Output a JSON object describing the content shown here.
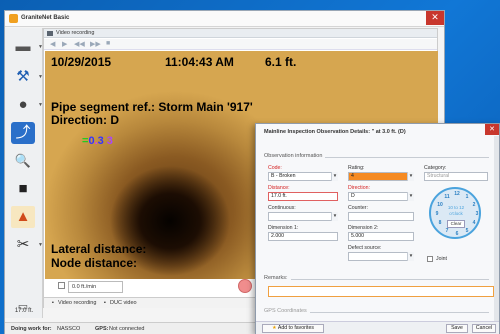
{
  "app": {
    "title": "GraniteNet Basic",
    "close_glyph": "✕"
  },
  "toolbar": {
    "tools": [
      {
        "icon": "monitor-icon",
        "glyph": "▬"
      },
      {
        "icon": "camera-tripod-icon",
        "glyph": "⚒"
      },
      {
        "icon": "crawler-icon",
        "glyph": "●"
      },
      {
        "icon": "pipe-reverse-icon",
        "glyph": "⤴"
      },
      {
        "icon": "magnifier-icon",
        "glyph": "🔍"
      },
      {
        "icon": "video-camera-icon",
        "glyph": "■"
      },
      {
        "icon": "map-icon",
        "glyph": "▲"
      },
      {
        "icon": "tools-icon",
        "glyph": "✂"
      }
    ],
    "distance": "17.0 ft."
  },
  "video": {
    "header_label": "Video recording",
    "osd": {
      "date": "10/29/2015",
      "time": "11:04:43 AM",
      "distance": "6.1 ft.",
      "segment": "Pipe segment ref.:  Storm Main '917'",
      "direction": "Direction:  D",
      "lateral": "Lateral distance:",
      "node": "Node distance:"
    },
    "speed": "0.0 ft./min",
    "tabs": [
      "Video recording",
      "DUC video"
    ]
  },
  "status": {
    "doing_label": "Doing work for:",
    "doing_value": "NASSCO",
    "gps_label": "GPS:",
    "gps_value": "Not connected"
  },
  "dialog": {
    "title": "Mainline Inspection Observation Details: \" at 3.0 ft. (D)",
    "close_glyph": "✕",
    "section_observation": "Observation information",
    "code_label": "Code:",
    "code_value": "B - Broken",
    "rating_label": "Rating:",
    "rating_value": "4",
    "category_label": "Category:",
    "category_value": "Structural",
    "distance_label": "Distance:",
    "distance_value": "17.0 ft.",
    "direction_label": "Direction:",
    "direction_value": "D",
    "continuous_label": "Continuous:",
    "counter_label": "Counter:",
    "dim1_label": "Dimension 1:",
    "dim1_value": "2.000",
    "dim2_label": "Dimension 2:",
    "dim2_value": "5.000",
    "defect_label": "Defect source:",
    "joint_label": "Joint",
    "clock_numbers": [
      "12",
      "1",
      "2",
      "3",
      "4",
      "5",
      "6",
      "7",
      "8",
      "9",
      "10",
      "11"
    ],
    "clock_readout": "10 to 12 o'clock",
    "clock_clear": "Clear",
    "section_remarks": "Remarks:",
    "section_gps": "GPS Coordinates",
    "add_favorites": "Add to favorites",
    "save": "Save",
    "cancel": "Cancel"
  },
  "colors": {
    "rating_highlight": "#f58a22",
    "required_label": "#d42020",
    "clock_accent": "#4aa3dd"
  }
}
